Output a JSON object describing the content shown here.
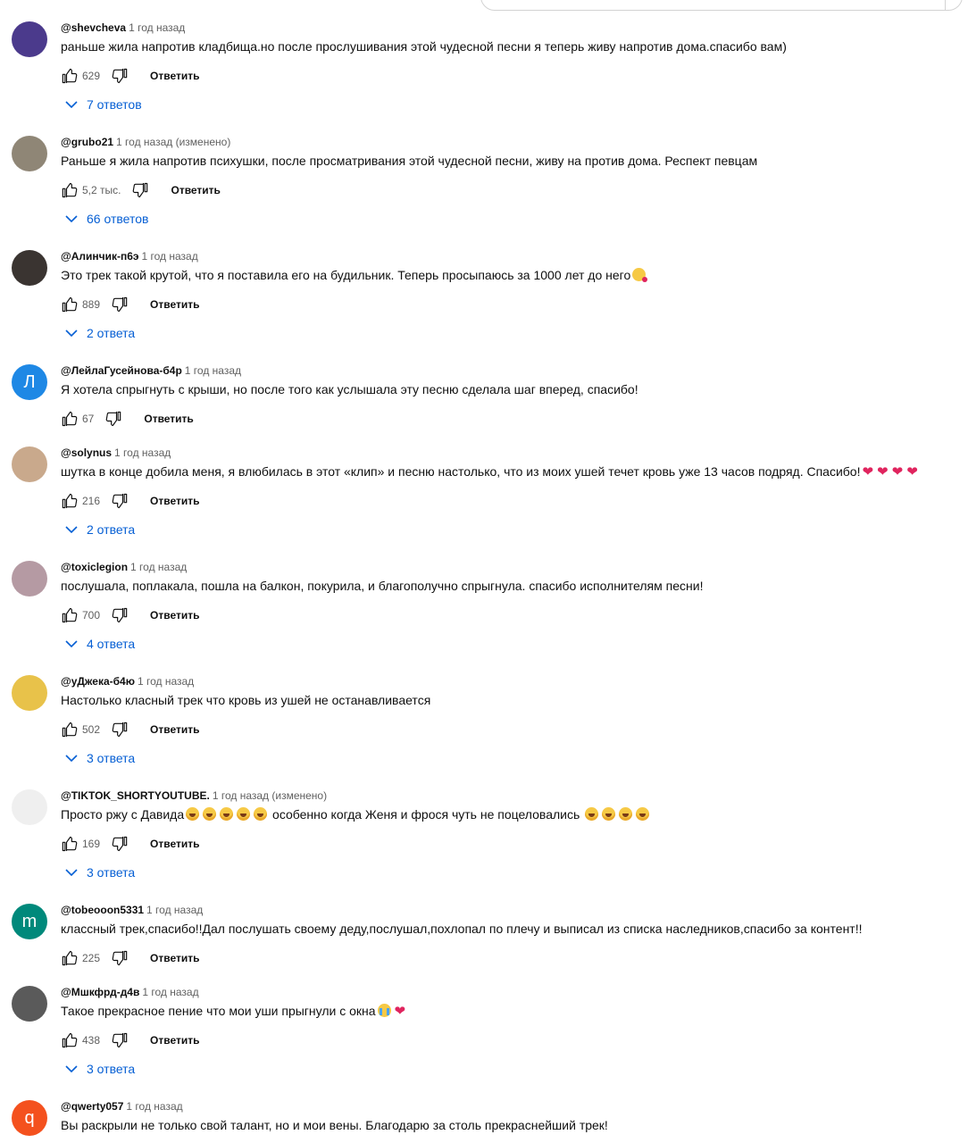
{
  "reply_label": "Ответить",
  "comments": [
    {
      "author": "@shevcheva",
      "meta": "1 год назад",
      "text": "раньше жила напротив кладбища.но после прослушивания этой чудесной песни я теперь живу напротив дома.спасибо вам)",
      "likes": "629",
      "replies": "7 ответов",
      "avatar": {
        "color": "#4b3a8c"
      }
    },
    {
      "author": "@grubo21",
      "meta": "1 год назад (изменено)",
      "text": "Раньше я жила напротив психушки, после просматривания этой чудесной песни, живу на против дома. Респект певцам",
      "likes": "5,2 тыс.",
      "replies": "66 ответов",
      "avatar": {
        "color": "#8f8676"
      }
    },
    {
      "author": "@Алинчик-п6э",
      "meta": "1 год назад",
      "text": "Это трек такой крутой, что я поставила его на будильник. Теперь просыпаюсь за 1000 лет до него",
      "emoji_after": "kiss",
      "likes": "889",
      "replies": "2 ответа",
      "avatar": {
        "color": "#3a3431"
      }
    },
    {
      "author": "@ЛейлаГусейнова-б4р",
      "meta": "1 год назад",
      "text": "Я хотела спрыгнуть с крыши, но после того как услышала эту песню сделала шаг вперед, спасибо!",
      "likes": "67",
      "replies": "",
      "avatar": {
        "color": "#1e88e5",
        "letter": "Л"
      }
    },
    {
      "author": "@solynus",
      "meta": "1 год назад",
      "text": "шутка в конце добила меня, я влюбилась в этот «клип» и песню настолько, что из моих ушей течет кровь уже 13 часов подряд. Спасибо!",
      "hearts": 4,
      "likes": "216",
      "replies": "2 ответа",
      "avatar": {
        "color": "#c9a98c"
      }
    },
    {
      "author": "@toxiclegion",
      "meta": "1 год назад",
      "text": "послушала, поплакала, пошла на балкон, покурила, и благополучно спрыгнула. спасибо исполнителям песни!",
      "likes": "700",
      "replies": "4 ответа",
      "avatar": {
        "color": "#b59aa3"
      }
    },
    {
      "author": "@уДжека-б4ю",
      "meta": "1 год назад",
      "text": "Настолько класный трек что кровь из ушей не останавливается",
      "likes": "502",
      "replies": "3 ответа",
      "avatar": {
        "color": "#e8c24a"
      }
    },
    {
      "author": "@TIKTOK_SHORTYOUTUBE.",
      "meta": "1 год назад (изменено)",
      "text": "Просто ржу с Давида",
      "laughs_1": 5,
      "text_2": " особенно когда Женя и фрося чуть не поцеловались ",
      "laughs_2": 4,
      "likes": "169",
      "replies": "3 ответа",
      "avatar": {
        "color": "#efefef"
      }
    },
    {
      "author": "@tobeooon5331",
      "meta": "1 год назад",
      "text": "классный трек,спасибо!!Дал послушать своему деду,послушал,похлопал по плечу и выписал из списка наследников,спасибо за контент!!",
      "likes": "225",
      "replies": "",
      "avatar": {
        "color": "#00897b",
        "letter": "m"
      }
    },
    {
      "author": "@Мшкфрд-д4в",
      "meta": "1 год назад",
      "text": "Такое прекрасное пение что мои уши прыгнули с окна",
      "emoji_after": "cry",
      "heart_after": true,
      "likes": "438",
      "replies": "3 ответа",
      "avatar": {
        "color": "#5a5a5a"
      }
    },
    {
      "author": "@qwerty057",
      "meta": "1 год назад",
      "text": "Вы раскрыли не только свой талант, но и мои вены. Благодарю за столь прекраснейший трек!",
      "likes": "",
      "replies": "",
      "avatar": {
        "color": "#f4511e",
        "letter": "q"
      }
    }
  ]
}
